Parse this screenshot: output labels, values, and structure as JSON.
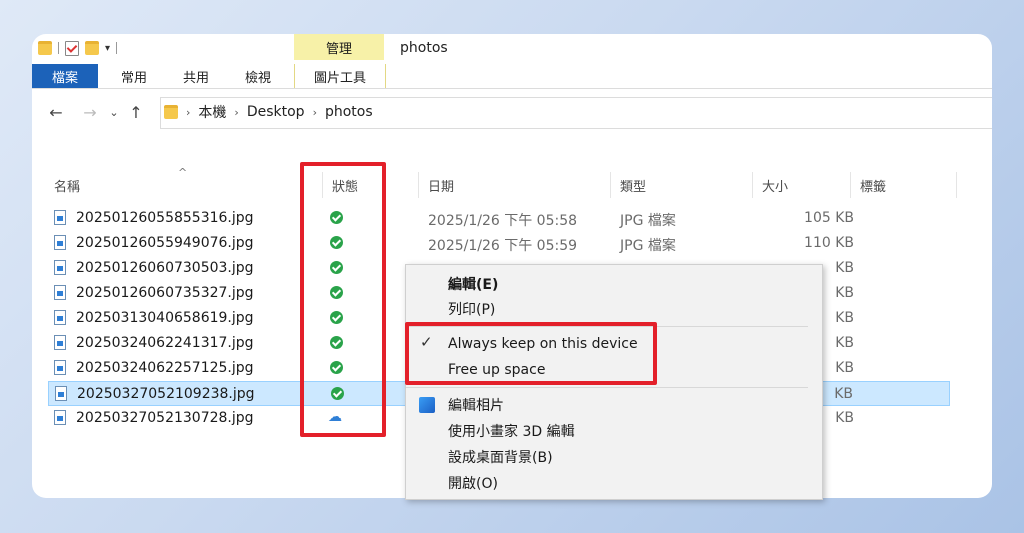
{
  "window_title": "photos",
  "ribbon": {
    "contextual_group": "管理",
    "tabs": [
      "檔案",
      "常用",
      "共用",
      "檢視",
      "圖片工具"
    ]
  },
  "address": {
    "crumbs": [
      "本機",
      "Desktop",
      "photos"
    ]
  },
  "columns": [
    "名稱",
    "狀態",
    "日期",
    "類型",
    "大小",
    "標籤"
  ],
  "files": [
    {
      "name": "20250126055855316.jpg",
      "status": "ok",
      "date": "2025/1/26 下午 05:58",
      "type": "JPG 檔案",
      "size": "105 KB"
    },
    {
      "name": "20250126055949076.jpg",
      "status": "ok",
      "date": "2025/1/26 下午 05:59",
      "type": "JPG 檔案",
      "size": "110 KB"
    },
    {
      "name": "20250126060730503.jpg",
      "status": "ok",
      "date": "",
      "type": "",
      "size": "KB"
    },
    {
      "name": "20250126060735327.jpg",
      "status": "ok",
      "date": "",
      "type": "",
      "size": "KB"
    },
    {
      "name": "20250313040658619.jpg",
      "status": "ok",
      "date": "",
      "type": "",
      "size": "KB"
    },
    {
      "name": "20250324062241317.jpg",
      "status": "ok",
      "date": "",
      "type": "",
      "size": "KB"
    },
    {
      "name": "20250324062257125.jpg",
      "status": "ok",
      "date": "",
      "type": "",
      "size": "KB"
    },
    {
      "name": "20250327052109238.jpg",
      "status": "ok",
      "date": "",
      "type": "",
      "size": "KB",
      "selected": true
    },
    {
      "name": "20250327052130728.jpg",
      "status": "cloud",
      "date": "",
      "type": "",
      "size": "KB"
    }
  ],
  "context_menu": {
    "edit": "編輯(E)",
    "print": "列印(P)",
    "always_keep": "Always keep on this device",
    "free_up": "Free up space",
    "edit_photos": "編輯相片",
    "paint3d": "使用小畫家 3D 編輯",
    "set_background": "設成桌面背景(B)",
    "open": "開啟(O)"
  },
  "colors": {
    "highlight": "#e3202a",
    "file_tab": "#1c62b9",
    "status_ok": "#2aa34a",
    "selection": "#cce8ff"
  }
}
